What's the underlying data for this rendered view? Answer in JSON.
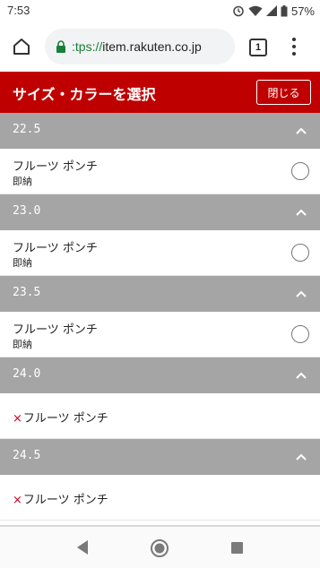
{
  "status": {
    "time": "7:53",
    "battery": "57%"
  },
  "browser": {
    "url_scheme": ":tps://",
    "url_host": "item.rakuten.co.jp",
    "tab_count": "1"
  },
  "panel": {
    "title": "サイズ・カラーを選択",
    "close_label": "閉じる"
  },
  "sizes": [
    {
      "size": "22.5",
      "color": "フルーツ ポンチ",
      "stock": "即納",
      "available": true
    },
    {
      "size": "23.0",
      "color": "フルーツ ポンチ",
      "stock": "即納",
      "available": true
    },
    {
      "size": "23.5",
      "color": "フルーツ ポンチ",
      "stock": "即納",
      "available": true
    },
    {
      "size": "24.0",
      "color": "フルーツ ポンチ",
      "sold_out_mark": "×",
      "available": false
    },
    {
      "size": "24.5",
      "color": "フルーツ ポンチ",
      "sold_out_mark": "×",
      "available": false
    }
  ],
  "icons": {
    "home": "home-icon",
    "lock": "lock-icon",
    "menu": "more-vert-icon",
    "chevron": "chevron-up-icon",
    "nav_back": "back-triangle-icon",
    "nav_home": "home-circle-icon",
    "nav_recent": "recents-square-icon"
  },
  "colors": {
    "header_red": "#bf0000",
    "size_header_gray": "#a5a5a5",
    "secure_green": "#188038",
    "soldout_red": "#d0021b"
  }
}
